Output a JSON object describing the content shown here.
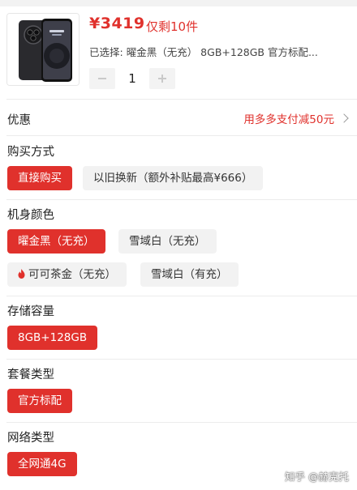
{
  "product": {
    "price": "¥3419",
    "stock": "仅剩10件",
    "selected_label": "已选择:",
    "selected_value": "曜金黑（无充） 8GB+128GB 官方标配...",
    "quantity": "1",
    "minus_icon": "minus-icon",
    "plus_icon": "plus-icon"
  },
  "promo": {
    "title": "优惠",
    "value": "用多多支付减50元",
    "icon": "chevron-right-icon"
  },
  "purchase_method": {
    "title": "购买方式",
    "options": [
      "直接购买",
      "以旧换新（额外补贴最高¥666）"
    ],
    "selected_index": 0
  },
  "color": {
    "title": "机身颜色",
    "options": [
      "曜金黑（无充）",
      "雪域白（无充）",
      "可可茶金（无充）",
      "雪域白（有充）"
    ],
    "selected_index": 0,
    "hot_icon": "flame-icon"
  },
  "storage": {
    "title": "存储容量",
    "options": [
      "8GB+128GB"
    ],
    "selected_index": 0
  },
  "package": {
    "title": "套餐类型",
    "options": [
      "官方标配"
    ],
    "selected_index": 0
  },
  "network": {
    "title": "网络类型",
    "options": [
      "全网通4G"
    ],
    "selected_index": 0
  },
  "watermark": "知乎 @赫克托",
  "colors": {
    "accent": "#e0312c",
    "chip_bg": "#f2f2f2"
  }
}
